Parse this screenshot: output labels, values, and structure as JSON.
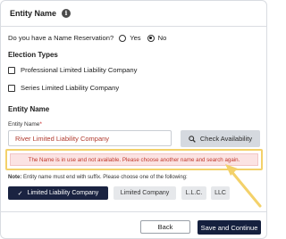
{
  "header": {
    "title": "Entity Name",
    "info_icon": "i"
  },
  "reservation": {
    "question": "Do you have a Name Reservation?",
    "options": [
      {
        "label": "Yes",
        "checked": false
      },
      {
        "label": "No",
        "checked": true
      }
    ]
  },
  "election": {
    "title": "Election Types",
    "options": [
      {
        "label": "Professional Limited Liability Company",
        "checked": false
      },
      {
        "label": "Series Limited Liability Company",
        "checked": false
      }
    ]
  },
  "entity_name": {
    "section_title": "Entity Name",
    "field_label": "Entity Name",
    "required_mark": "*",
    "value": "River Limited Liability Company",
    "check_button": "Check Availability",
    "error": "The Name is in use and not available. Please choose another name and search again.",
    "note_label": "Note:",
    "note_text": "Entity name must end with suffix. Please choose one of the following:"
  },
  "suffixes": [
    {
      "label": "Limited Liability Company",
      "selected": true,
      "check": "✓"
    },
    {
      "label": "Limited Company",
      "selected": false
    },
    {
      "label": "L.L.C.",
      "selected": false
    },
    {
      "label": "LLC",
      "selected": false
    }
  ],
  "footer": {
    "back_label": "Back",
    "save_label": "Save and Continue"
  },
  "colors": {
    "primary": "#15203e",
    "error_text": "#c0392b",
    "error_bg": "#fbe3e3",
    "highlight": "#f3d16a"
  }
}
